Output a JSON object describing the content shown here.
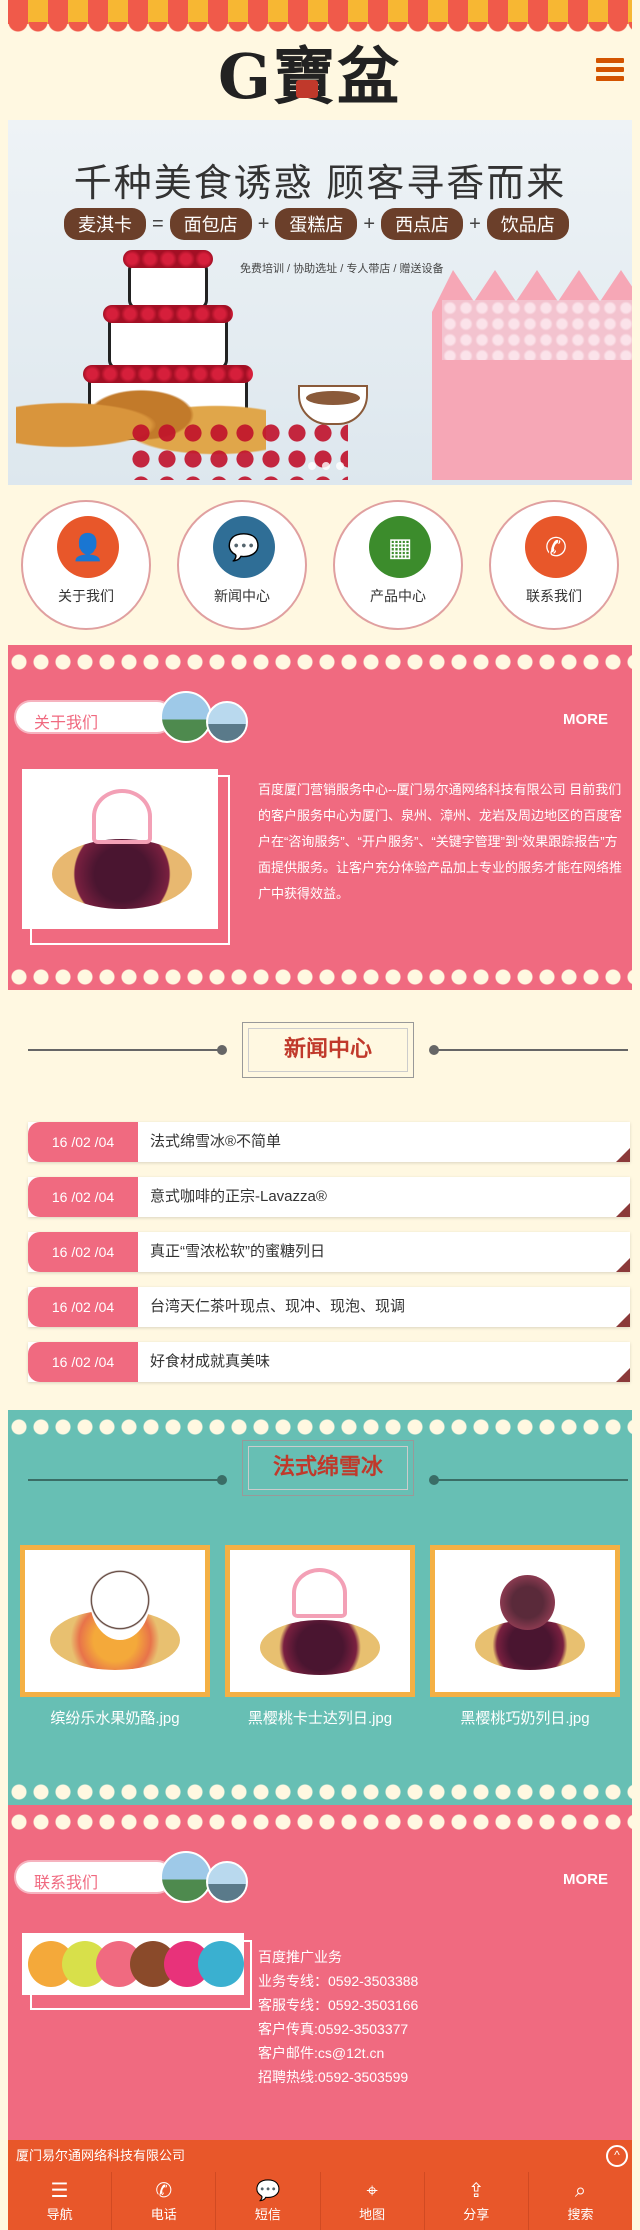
{
  "brand": {
    "logo_text": "G寶盆"
  },
  "banner": {
    "headline": "千种美食诱惑  顾客寻香而来",
    "tags": [
      "麦淇卡",
      "面包店",
      "蛋糕店",
      "西点店",
      "饮品店"
    ],
    "ops": [
      "=",
      "+",
      "+",
      "+"
    ],
    "subline": "免费培训 / 协助选址 / 专人带店 / 赠送设备"
  },
  "quicknav": [
    {
      "label": "关于我们",
      "icon": "user-icon",
      "color": "#e8572a",
      "glyph": "👤"
    },
    {
      "label": "新闻中心",
      "icon": "chat-icon",
      "color": "#2f6e96",
      "glyph": "💬"
    },
    {
      "label": "产品中心",
      "icon": "grid-icon",
      "color": "#3c8c2c",
      "glyph": "▦"
    },
    {
      "label": "联系我们",
      "icon": "phone-icon",
      "color": "#e8572a",
      "glyph": "✆"
    }
  ],
  "about": {
    "heading": "关于我们",
    "more": "MORE",
    "text": "百度厦门营销服务中心--厦门易尔通网络科技有限公司 目前我们的客户服务中心为厦门、泉州、漳州、龙岩及周边地区的百度客户在“咨询服务”、“开户服务”、“关键字管理”到“效果跟踪报告”方面提供服务。让客户充分体验产品加上专业的服务才能在网络推广中获得效益。"
  },
  "news": {
    "heading": "新闻中心",
    "items": [
      {
        "date": "16 /02 /04",
        "title": "法式绵雪冰®不简单"
      },
      {
        "date": "16 /02 /04",
        "title": "意式咖啡的正宗-Lavazza®"
      },
      {
        "date": "16 /02 /04",
        "title": "真正“雪浓松软”的蜜糖列日"
      },
      {
        "date": "16 /02 /04",
        "title": "台湾天仁茶叶现点、现冲、现泡、现调"
      },
      {
        "date": "16 /02 /04",
        "title": "好食材成就真美味"
      }
    ]
  },
  "products": {
    "heading": "法式绵雪冰",
    "items": [
      {
        "name": "缤纷乐水果奶酪.jpg"
      },
      {
        "name": "黑樱桃卡士达列日.jpg"
      },
      {
        "name": "黑樱桃巧奶列日.jpg"
      }
    ]
  },
  "contact": {
    "heading": "联系我们",
    "more": "MORE",
    "lines": [
      "百度推广业务",
      "业务专线：0592-3503388",
      "客服专线：0592-3503166",
      "客户传真:0592-3503377",
      "客户邮件:cs@12t.cn",
      "招聘热线:0592-3503599"
    ]
  },
  "footer": {
    "company": "厦门易尔通网络科技有限公司",
    "top_glyph": "^",
    "nav": [
      {
        "label": "导航",
        "icon": "menu-icon",
        "glyph": "☰"
      },
      {
        "label": "电话",
        "icon": "phone-icon",
        "glyph": "✆"
      },
      {
        "label": "短信",
        "icon": "message-icon",
        "glyph": "💬"
      },
      {
        "label": "地图",
        "icon": "map-icon",
        "glyph": "⌖"
      },
      {
        "label": "分享",
        "icon": "share-icon",
        "glyph": "⇪"
      },
      {
        "label": "搜索",
        "icon": "search-icon",
        "glyph": "⌕"
      }
    ]
  },
  "colors": {
    "accent": "#e8572a",
    "pink": "#f06a80",
    "teal": "#67bfb4",
    "cream": "#fff8e1"
  }
}
